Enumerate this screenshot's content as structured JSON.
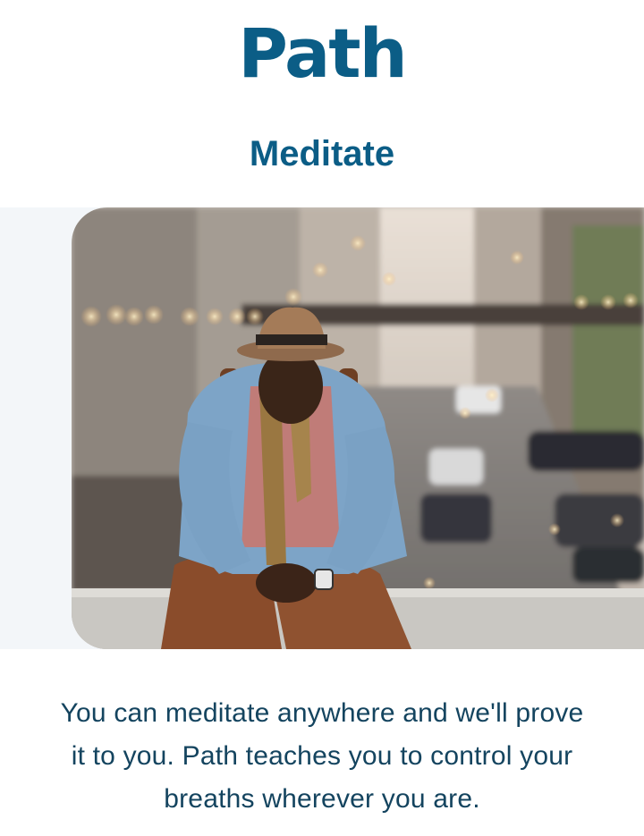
{
  "brand": {
    "logo_text": "Path"
  },
  "page": {
    "title": "Meditate"
  },
  "hero": {
    "image": "man-meditating-on-city-bridge-photo"
  },
  "description": {
    "text": "You can meditate anywhere and we'll prove it to you. Path teaches you to control your breaths wherever you are."
  },
  "colors": {
    "brand": "#0b5d86",
    "body_text": "#14445f",
    "panel": "#f3f6f9"
  }
}
